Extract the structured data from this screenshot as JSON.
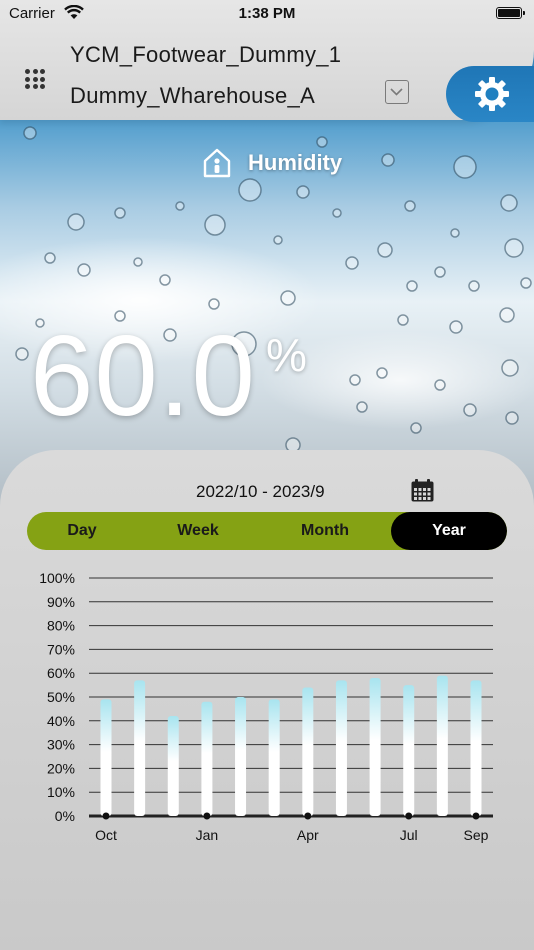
{
  "status_bar": {
    "carrier": "Carrier",
    "time": "1:38 PM"
  },
  "header": {
    "device_name": "YCM_Footwear_Dummy_1",
    "warehouse_name": "Dummy_Wharehouse_A"
  },
  "sensor": {
    "label": "Humidity",
    "value": "60.0",
    "unit": "%"
  },
  "period": {
    "range": "2022/10 - 2023/9"
  },
  "tabs": [
    {
      "label": "Day"
    },
    {
      "label": "Week"
    },
    {
      "label": "Month"
    },
    {
      "label": "Year"
    }
  ],
  "active_tab": "Year",
  "colors": {
    "tab_bg": "#85a214",
    "tab_active_bg": "#000000",
    "gear_bg": "#1f76b6",
    "bar_top": "#a8e4ef",
    "bar_bottom": "#ffffff"
  },
  "chart_data": {
    "type": "bar",
    "y_ticks": [
      "100%",
      "90%",
      "80%",
      "70%",
      "60%",
      "50%",
      "40%",
      "30%",
      "20%",
      "10%",
      "0%"
    ],
    "ylim": [
      0,
      100
    ],
    "categories": [
      "Oct",
      "Nov",
      "Dec",
      "Jan",
      "Feb",
      "Mar",
      "Apr",
      "May",
      "Jun",
      "Jul",
      "Aug",
      "Sep"
    ],
    "x_tick_labels": [
      "Oct",
      "",
      "",
      "Jan",
      "",
      "",
      "Apr",
      "",
      "",
      "Jul",
      "",
      "Sep"
    ],
    "values": [
      49,
      57,
      42,
      48,
      50,
      49,
      54,
      57,
      58,
      55,
      59,
      57
    ],
    "grid": true
  }
}
